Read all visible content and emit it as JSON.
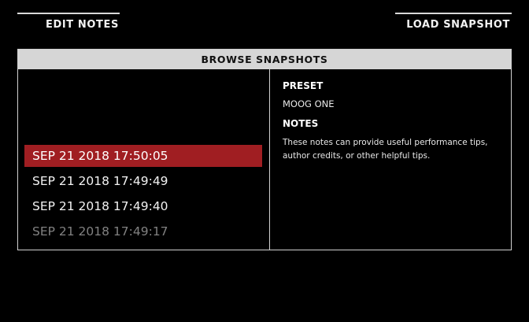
{
  "softkeys": {
    "left_label": "EDIT NOTES",
    "right_label": "LOAD SNAPSHOT"
  },
  "panel": {
    "title": "BROWSE SNAPSHOTS"
  },
  "snapshots": [
    {
      "label": "SEP 21 2018 17:50:05",
      "selected": true
    },
    {
      "label": "SEP 21 2018 17:49:49",
      "selected": false
    },
    {
      "label": "SEP 21 2018 17:49:40",
      "selected": false
    },
    {
      "label": "SEP 21 2018 17:49:17",
      "selected": false
    }
  ],
  "details": {
    "preset_heading": "PRESET",
    "preset_value": "MOOG ONE",
    "notes_heading": "NOTES",
    "notes_value": "These notes can provide useful performance tips, author credits, or other helpful tips."
  },
  "colors": {
    "selected_row": "#a01e22",
    "header_bg": "#d6d6d6"
  }
}
